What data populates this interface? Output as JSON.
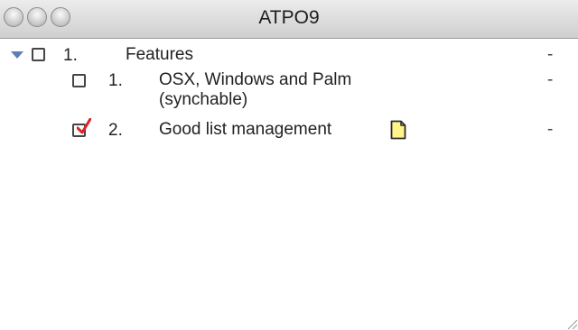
{
  "window": {
    "title": "ATPO9"
  },
  "outline": {
    "items": [
      {
        "number": "1.",
        "label": "Features",
        "checked": false,
        "expanded": true,
        "dash": "-"
      },
      {
        "number": "1.",
        "label_line1": "OSX, Windows and Palm",
        "label_line2": "(synchable)",
        "checked": false,
        "dash": "-"
      },
      {
        "number": "2.",
        "label": "Good list management",
        "checked": true,
        "has_note": true,
        "dash": "-"
      }
    ]
  },
  "icons": {
    "disclosure": "disclosure-triangle-open-icon",
    "checkbox": "checkbox-icon",
    "note": "note-icon",
    "resize": "resize-grip-icon"
  },
  "colors": {
    "checkmark": "#d9242b",
    "note_fill": "#fff48a",
    "disclosure": "#5d7fb5"
  }
}
